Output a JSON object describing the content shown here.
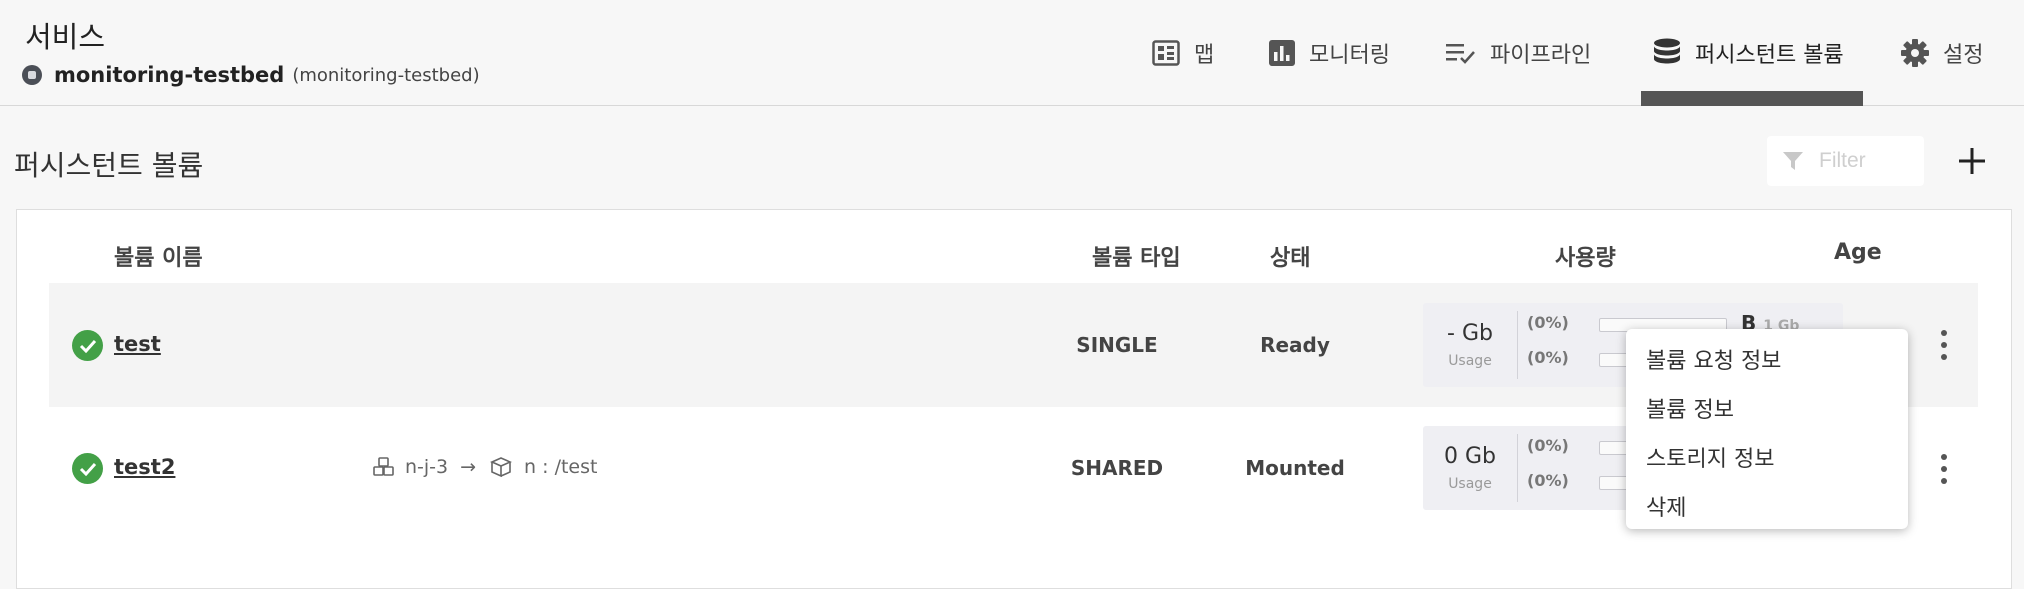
{
  "header": {
    "service_label": "서비스",
    "service_name": "monitoring-testbed",
    "service_namespace": "(monitoring-testbed)"
  },
  "nav": {
    "items": [
      {
        "label": "맵",
        "icon": "map-grid-icon"
      },
      {
        "label": "모니터링",
        "icon": "bar-chart-icon"
      },
      {
        "label": "파이프라인",
        "icon": "checklist-icon"
      },
      {
        "label": "퍼시스턴트 볼륨",
        "icon": "database-icon",
        "active": true
      },
      {
        "label": "설정",
        "icon": "gear-icon"
      }
    ]
  },
  "page": {
    "title": "퍼시스턴트 볼륨",
    "filter_placeholder": "Filter",
    "add_icon": "plus-icon"
  },
  "table": {
    "headers": {
      "name": "볼륨 이름",
      "type": "볼륨 타입",
      "status": "상태",
      "usage": "사용량",
      "age": "Age"
    },
    "rows": [
      {
        "name": "test",
        "type": "SINGLE",
        "status": "Ready",
        "usage_value": "- Gb",
        "usage_label": "Usage",
        "pct1": "(0%)",
        "pct2": "(0%)",
        "extra_letter": "B",
        "extra_size": "1 Gb"
      },
      {
        "name": "test2",
        "mount_source": "n-j-3",
        "mount_arrow": "→",
        "mount_target": "n : /test",
        "type": "SHARED",
        "status": "Mounted",
        "usage_value": "0 Gb",
        "usage_label": "Usage",
        "pct1": "(0%)",
        "pct2": "(0%)"
      }
    ]
  },
  "context_menu": {
    "items": [
      "볼륨 요청 정보",
      "볼륨 정보",
      "스토리지 정보",
      "삭제"
    ]
  },
  "colors": {
    "status_ok": "#43a047",
    "active_tab_underline": "#555555"
  }
}
